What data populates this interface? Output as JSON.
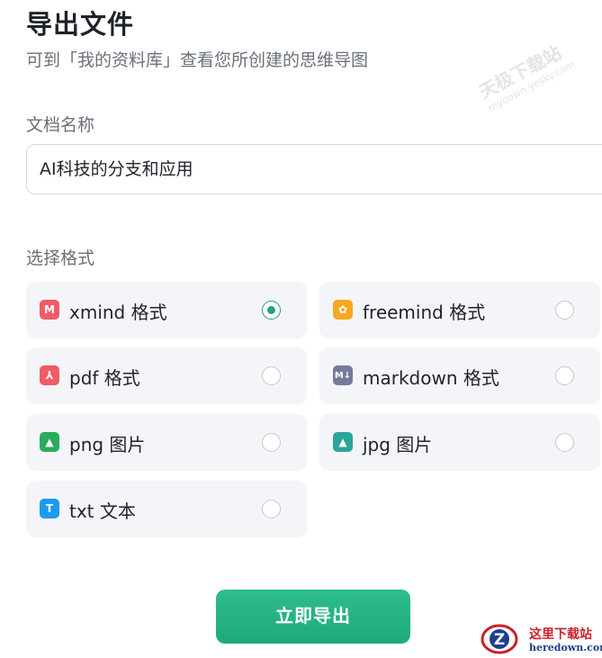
{
  "header": {
    "title": "导出文件",
    "subtitle": "可到「我的资料库」查看您所创建的思维导图"
  },
  "name_field": {
    "label": "文档名称",
    "value": "AI科技的分支和应用"
  },
  "format": {
    "label": "选择格式",
    "options": [
      {
        "label": "xmind 格式",
        "icon": "xmind-icon",
        "icon_glyph": "M",
        "selected": true
      },
      {
        "label": "freemind 格式",
        "icon": "freemind-icon",
        "icon_glyph": "✿",
        "selected": false
      },
      {
        "label": "pdf 格式",
        "icon": "pdf-icon",
        "icon_glyph": "⅄",
        "selected": false
      },
      {
        "label": "markdown 格式",
        "icon": "markdown-icon",
        "icon_glyph": "M↓",
        "selected": false
      },
      {
        "label": "png 图片",
        "icon": "image-icon",
        "icon_glyph": "▲",
        "selected": false
      },
      {
        "label": "jpg 图片",
        "icon": "image-icon",
        "icon_glyph": "▲",
        "selected": false
      },
      {
        "label": "txt 文本",
        "icon": "text-icon",
        "icon_glyph": "T",
        "selected": false
      }
    ]
  },
  "submit_label": "立即导出",
  "watermarks": {
    "top_text": "天极下载站",
    "top_url": "mydown.yesky.com",
    "bottom_text": "这里下载站",
    "bottom_url": "heredown.com"
  },
  "colors": {
    "accent": "#22a37a",
    "xmind": "#f15a67",
    "freemind": "#f5a821",
    "pdf": "#f15a67",
    "markdown": "#757a99",
    "png": "#2aab5d",
    "jpg": "#2aa59a",
    "txt": "#1b9bef"
  }
}
